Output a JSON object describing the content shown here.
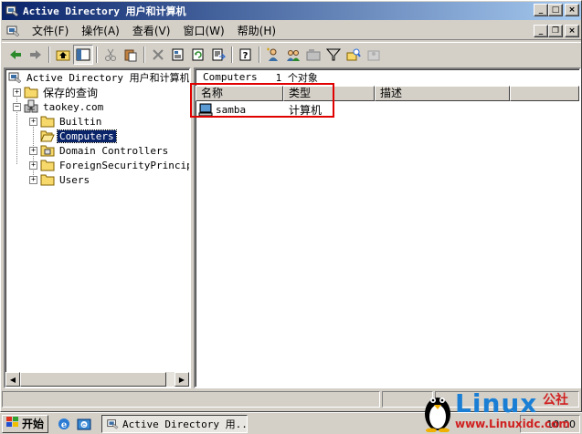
{
  "window": {
    "title": "Active Directory 用户和计算机"
  },
  "menu": {
    "items": [
      "文件(F)",
      "操作(A)",
      "查看(V)",
      "窗口(W)",
      "帮助(H)"
    ]
  },
  "tree": {
    "root": "Active Directory 用户和计算机",
    "saved_queries": "保存的查询",
    "domain": "taokey.com",
    "children": [
      "Builtin",
      "Computers",
      "Domain Controllers",
      "ForeignSecurityPrincipa",
      "Users"
    ],
    "selected": "Computers"
  },
  "list": {
    "container": "Computers",
    "count_text": "1 个对象",
    "columns": [
      "名称",
      "类型",
      "描述"
    ],
    "rows": [
      {
        "name": "samba",
        "type": "计算机",
        "description": ""
      }
    ]
  },
  "taskbar": {
    "start_label": "开始",
    "task_label": "Active Directory 用...",
    "clock": "10:00"
  },
  "watermark": {
    "brand": "Linux",
    "brand_cn": "公社",
    "url": "www.Linuxidc.com"
  },
  "colors": {
    "title_gradient_start": "#0a246a",
    "title_gradient_end": "#a6caf0",
    "highlight_box": "#e00000",
    "selection": "#0a246a"
  },
  "icons": {
    "app": "ad-users-computers-icon",
    "back": "back-arrow-icon",
    "forward": "forward-arrow-icon",
    "up": "up-folder-icon",
    "show_tree": "show-tree-icon",
    "cut": "cut-icon",
    "paste": "paste-icon",
    "delete": "delete-icon",
    "properties": "properties-icon",
    "refresh": "refresh-icon",
    "export": "export-list-icon",
    "help": "help-icon",
    "new_user": "new-user-icon",
    "new_group": "new-group-icon",
    "new_ou": "new-ou-icon",
    "filter": "filter-icon",
    "find": "find-icon",
    "add_to_group": "add-to-group-icon",
    "computer": "computer-icon",
    "folder": "folder-icon",
    "domain": "domain-icon"
  }
}
